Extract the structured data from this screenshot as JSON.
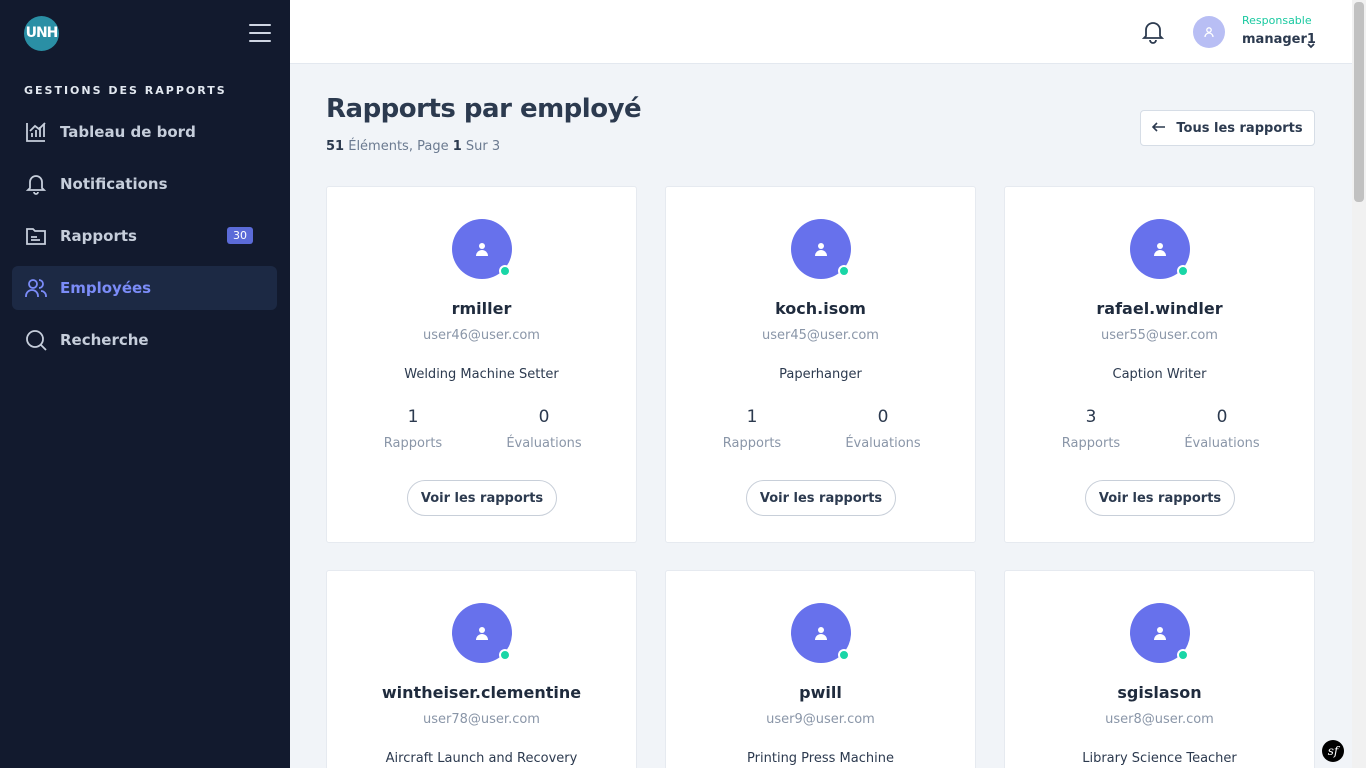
{
  "app": {
    "logo_text": "UNH"
  },
  "sidebar": {
    "section_title": "GESTIONS DES RAPPORTS",
    "items": [
      {
        "label": "Tableau de bord",
        "icon": "chart-bars-icon"
      },
      {
        "label": "Notifications",
        "icon": "bell-icon"
      },
      {
        "label": "Rapports",
        "icon": "folder-icon",
        "badge": "30"
      },
      {
        "label": "Employées",
        "icon": "users-icon",
        "active": true
      },
      {
        "label": "Recherche",
        "icon": "search-icon"
      }
    ]
  },
  "header": {
    "role": "Responsable",
    "username": "manager1"
  },
  "main": {
    "title": "Rapports par employé",
    "subtitle": {
      "count": "51",
      "count_label": "Éléments, Page",
      "page": "1",
      "total_label": "Sur 3"
    },
    "all_reports_label": "Tous les rapports",
    "stat_labels": {
      "reports": "Rapports",
      "evaluations": "Évaluations"
    },
    "view_button_label": "Voir les rapports",
    "employees": [
      {
        "username": "rmiller",
        "email": "user46@user.com",
        "job": "Welding Machine Setter",
        "reports": "1",
        "evaluations": "0"
      },
      {
        "username": "koch.isom",
        "email": "user45@user.com",
        "job": "Paperhanger",
        "reports": "1",
        "evaluations": "0"
      },
      {
        "username": "rafael.windler",
        "email": "user55@user.com",
        "job": "Caption Writer",
        "reports": "3",
        "evaluations": "0"
      },
      {
        "username": "wintheiser.clementine",
        "email": "user78@user.com",
        "job": "Aircraft Launch and Recovery"
      },
      {
        "username": "pwill",
        "email": "user9@user.com",
        "job": "Printing Press Machine"
      },
      {
        "username": "sgislason",
        "email": "user8@user.com",
        "job": "Library Science Teacher"
      }
    ]
  },
  "colors": {
    "sidebar_bg": "#121a2e",
    "accent": "#6771ec",
    "online": "#19d6a6",
    "role": "#19c9a0"
  }
}
